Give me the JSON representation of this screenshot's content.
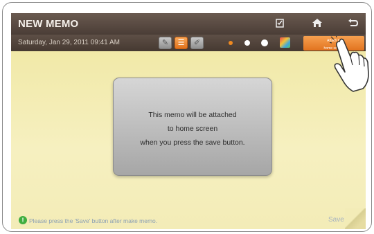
{
  "titlebar": {
    "title": "NEW MEMO",
    "icons": [
      "memo-save-icon",
      "home-icon",
      "back-icon"
    ]
  },
  "toolbar": {
    "date": "Saturday, Jan 29, 2011 09:41 AM",
    "tools": [
      "pen-icon",
      "memo-icon",
      "eraser-icon"
    ],
    "active_tool": "memo-icon",
    "colors": [
      "#f08a20",
      "#ffffff",
      "#ffffff",
      "#ffffff"
    ],
    "menu_label_line1": "Attach to",
    "menu_label_line2": "home screen"
  },
  "popup": {
    "line1": "This memo will be attached",
    "line2": "to home screen",
    "line3": "when you press the save button."
  },
  "footer": {
    "hint": "Please press the 'Save' button after make memo.",
    "save_label": "Save"
  }
}
